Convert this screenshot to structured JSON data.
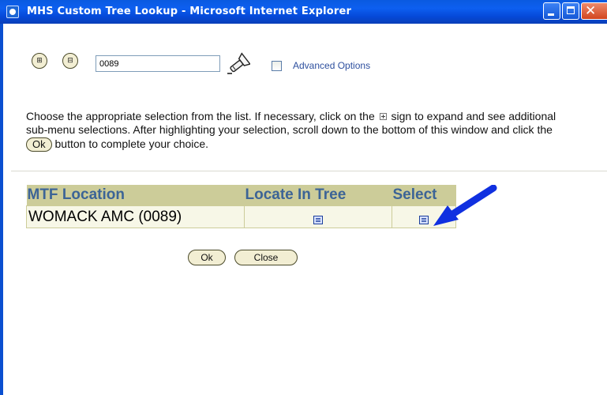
{
  "window": {
    "title": "MHS Custom Tree Lookup - Microsoft Internet Explorer",
    "minimize_icon": "minimize-icon",
    "maximize_icon": "maximize-icon",
    "close_icon": "close-icon",
    "title_color": "#0a5ae0"
  },
  "toolbar": {
    "expand_all_label": "⊞",
    "collapse_all_label": "⊟",
    "search_value": "0089",
    "search_icon": "flashlight-icon",
    "advanced_options_label": "Advanced Options",
    "advanced_options_checked": false
  },
  "instructions": {
    "part1": "Choose the appropriate selection from the list. If necessary, click on the",
    "part2": "sign to expand and see additional sub-menu selections. After highlighting your selection, scroll down to the bottom of this window and click the",
    "ok_label": "Ok",
    "part3": "button to complete your choice."
  },
  "table": {
    "headers": [
      "MTF Location",
      "Locate In Tree",
      "Select"
    ],
    "rows": [
      {
        "location": "WOMACK AMC (0089)",
        "locate_icon": "document-icon",
        "select_icon": "document-icon"
      }
    ],
    "header_bg": "#cccc99",
    "header_text": "#3c6496"
  },
  "buttons": {
    "ok": "Ok",
    "close": "Close"
  },
  "annotation": {
    "arrow_icon": "arrow-pointer-icon",
    "arrow_color": "#1030e0"
  }
}
